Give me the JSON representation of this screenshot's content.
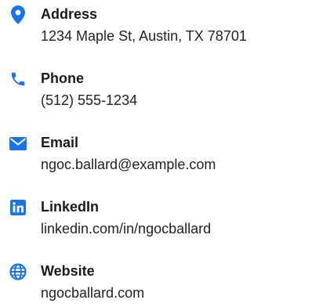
{
  "theme": {
    "icon_color": "#1a73e8",
    "label_color": "#1a1a1a",
    "value_color": "#222222"
  },
  "contacts": [
    {
      "icon": "map-pin-icon",
      "label": "Address",
      "value": "1234 Maple St, Austin, TX 78701"
    },
    {
      "icon": "phone-icon",
      "label": "Phone",
      "value": "(512) 555-1234"
    },
    {
      "icon": "envelope-icon",
      "label": "Email",
      "value": "ngoc.ballard@example.com"
    },
    {
      "icon": "linkedin-icon",
      "label": "LinkedIn",
      "value": "linkedin.com/in/ngocballard"
    },
    {
      "icon": "globe-icon",
      "label": "Website",
      "value": "ngocballard.com"
    }
  ]
}
